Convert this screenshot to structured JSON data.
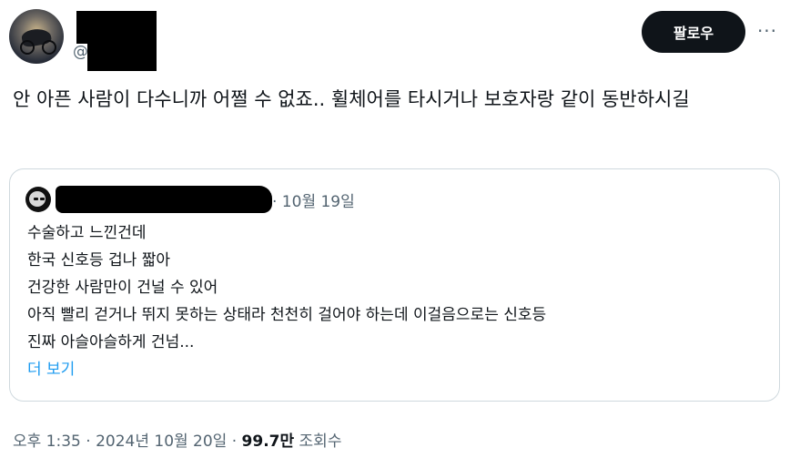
{
  "author": {
    "handle_prefix": "@"
  },
  "actions": {
    "follow_label": "팔로우",
    "more_label": "···"
  },
  "tweet": {
    "text": "안 아픈 사람이 다수니까 어쩔 수 없죠.. 휠체어를 타시거나 보호자랑 같이 동반하시길"
  },
  "quoted": {
    "date": "· 10월 19일",
    "lines": [
      "수술하고 느낀건데",
      "한국 신호등 겁나 짧아",
      "건강한 사람만이 건널 수 있어",
      "아직 빨리 걷거나 뛰지 못하는 상태라 천천히 걸어야 하는데 이걸음으로는 신호등",
      "진짜 아슬아슬하게 건넘..."
    ],
    "show_more": "더 보기"
  },
  "meta": {
    "timestamp": "오후 1:35 · 2024년 10월 20일 · ",
    "views_count": "99.7만",
    "views_label": " 조회수"
  }
}
